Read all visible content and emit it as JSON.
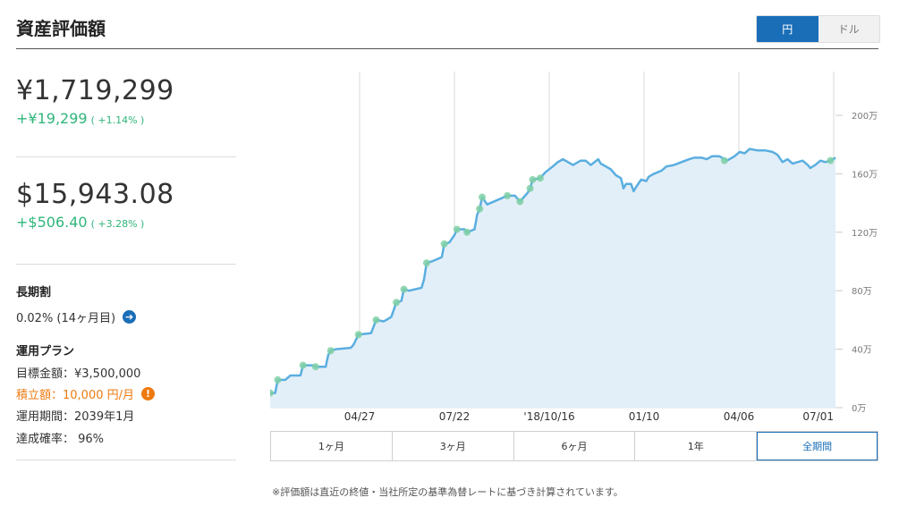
{
  "header": {
    "title": "資産評価額"
  },
  "currency_toggle": {
    "yen": "円",
    "dollar": "ドル",
    "selected": "円"
  },
  "yen_summary": {
    "value": "¥1,719,299",
    "change": "+¥19,299",
    "change_pct": "( +1.14% )"
  },
  "usd_summary": {
    "value": "$15,943.08",
    "change": "+$506.40",
    "change_pct": "( +3.28% )"
  },
  "long_term_discount": {
    "label": "長期割",
    "value": "0.02% (14ヶ月目)"
  },
  "plan": {
    "label": "運用プラン",
    "target": "目標金額：¥3,500,000",
    "contribution": "積立額：10,000 円/月",
    "period": "運用期間：2039年1月",
    "probability": "達成確率： 96%"
  },
  "range_tabs": [
    "1ヶ月",
    "3ヶ月",
    "6ヶ月",
    "1年",
    "全期間"
  ],
  "range_selected": "全期間",
  "footnote": "※評価額は直近の終値・当社所定の基準為替レートに基づき計算されています。",
  "colors": {
    "accent": "#1a6eb8",
    "positive": "#2fb67a",
    "warning": "#ee7a10",
    "line": "#5aaee0",
    "area": "#e3eff8"
  },
  "chart_data": {
    "type": "area",
    "x_ticks": [
      "04/27",
      "07/22",
      "'18/10/16",
      "01/10",
      "04/06",
      "07/01"
    ],
    "y_ticks": [
      "0万",
      "40万",
      "80万",
      "120万",
      "160万",
      "200万"
    ],
    "ylim": [
      0,
      200
    ],
    "unit": "万",
    "series": [
      {
        "values": [
          [
            0,
            10
          ],
          [
            2,
            10
          ],
          [
            3,
            19
          ],
          [
            6,
            19
          ],
          [
            8,
            22
          ],
          [
            12,
            22
          ],
          [
            13,
            29
          ],
          [
            17,
            29
          ],
          [
            18,
            28
          ],
          [
            22,
            28
          ],
          [
            23,
            36
          ],
          [
            24,
            39
          ],
          [
            26,
            40
          ],
          [
            32,
            41
          ],
          [
            33,
            43
          ],
          [
            35,
            50
          ],
          [
            40,
            51
          ],
          [
            42,
            60
          ],
          [
            45,
            59
          ],
          [
            48,
            62
          ],
          [
            50,
            72
          ],
          [
            52,
            73
          ],
          [
            53,
            81
          ],
          [
            55,
            80
          ],
          [
            60,
            82
          ],
          [
            61,
            88
          ],
          [
            62,
            99
          ],
          [
            64,
            100
          ],
          [
            68,
            103
          ],
          [
            69,
            112
          ],
          [
            71,
            113
          ],
          [
            73,
            118
          ],
          [
            74,
            122
          ],
          [
            77,
            122
          ],
          [
            78,
            120
          ],
          [
            81,
            122
          ],
          [
            82,
            132
          ],
          [
            83,
            136
          ],
          [
            84,
            144
          ],
          [
            86,
            139
          ],
          [
            90,
            142
          ],
          [
            94,
            145
          ],
          [
            97,
            145
          ],
          [
            99,
            141
          ],
          [
            102,
            147
          ],
          [
            103,
            150
          ],
          [
            104,
            156
          ],
          [
            107,
            157
          ],
          [
            109,
            161
          ],
          [
            112,
            165
          ],
          [
            114,
            168
          ],
          [
            116,
            170
          ],
          [
            118,
            168
          ],
          [
            120,
            166
          ],
          [
            123,
            169
          ],
          [
            125,
            169
          ],
          [
            127,
            166
          ],
          [
            130,
            170
          ],
          [
            131,
            167
          ],
          [
            133,
            165
          ],
          [
            135,
            163
          ],
          [
            137,
            159
          ],
          [
            139,
            157
          ],
          [
            140,
            150
          ],
          [
            141,
            153
          ],
          [
            143,
            153
          ],
          [
            144,
            148
          ],
          [
            145,
            151
          ],
          [
            147,
            156
          ],
          [
            149,
            155
          ],
          [
            150,
            158
          ],
          [
            152,
            160
          ],
          [
            155,
            162
          ],
          [
            157,
            165
          ],
          [
            160,
            166
          ],
          [
            163,
            168
          ],
          [
            166,
            170
          ],
          [
            168,
            171
          ],
          [
            171,
            171
          ],
          [
            173,
            170
          ],
          [
            175,
            172
          ],
          [
            178,
            172
          ],
          [
            181,
            169
          ],
          [
            184,
            172
          ],
          [
            186,
            175
          ],
          [
            188,
            174
          ],
          [
            190,
            177
          ],
          [
            193,
            176
          ],
          [
            196,
            176
          ],
          [
            199,
            175
          ],
          [
            201,
            173
          ],
          [
            203,
            168
          ],
          [
            205,
            170
          ],
          [
            207,
            167
          ],
          [
            209,
            168
          ],
          [
            211,
            169
          ],
          [
            213,
            166
          ],
          [
            214,
            164
          ],
          [
            216,
            166
          ],
          [
            218,
            169
          ],
          [
            220,
            168
          ],
          [
            222,
            169
          ],
          [
            224,
            171
          ]
        ],
        "markers": [
          [
            0,
            10
          ],
          [
            3,
            19
          ],
          [
            13,
            29
          ],
          [
            18,
            28
          ],
          [
            24,
            39
          ],
          [
            35,
            50
          ],
          [
            42,
            60
          ],
          [
            50,
            72
          ],
          [
            53,
            81
          ],
          [
            62,
            99
          ],
          [
            69,
            112
          ],
          [
            74,
            122
          ],
          [
            78,
            120
          ],
          [
            83,
            136
          ],
          [
            84,
            144
          ],
          [
            94,
            145
          ],
          [
            99,
            141
          ],
          [
            103,
            150
          ],
          [
            104,
            156
          ],
          [
            107,
            157
          ],
          [
            180,
            169
          ],
          [
            222,
            169
          ]
        ]
      }
    ],
    "grid": "vertical"
  }
}
